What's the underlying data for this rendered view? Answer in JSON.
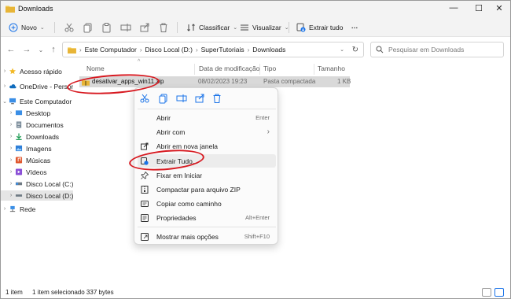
{
  "window": {
    "title": "Downloads"
  },
  "window_controls": {
    "minimize": "—",
    "maximize": "☐",
    "close": "✕"
  },
  "commandbar": {
    "new_label": "Novo",
    "sort_label": "Classificar",
    "view_label": "Visualizar",
    "extract_label": "Extrair tudo",
    "more_label": "···"
  },
  "addressbar": {
    "crumbs": [
      "Este Computador",
      "Disco Local (D:)",
      "SuperTutoriais",
      "Downloads"
    ],
    "separator": "›",
    "search_placeholder": "Pesquisar em Downloads"
  },
  "navpane": {
    "items": [
      {
        "label": "Acesso rápido",
        "level": 0,
        "chev": "›"
      },
      {
        "label": "OneDrive - Personal",
        "level": 0,
        "chev": "›"
      },
      {
        "label": "Este Computador",
        "level": 0,
        "chev": "⌄"
      },
      {
        "label": "Desktop",
        "level": 1,
        "chev": "›"
      },
      {
        "label": "Documentos",
        "level": 1,
        "chev": "›"
      },
      {
        "label": "Downloads",
        "level": 1,
        "chev": "›"
      },
      {
        "label": "Imagens",
        "level": 1,
        "chev": "›"
      },
      {
        "label": "Músicas",
        "level": 1,
        "chev": "›"
      },
      {
        "label": "Vídeos",
        "level": 1,
        "chev": "›"
      },
      {
        "label": "Disco Local (C:)",
        "level": 1,
        "chev": "›"
      },
      {
        "label": "Disco Local (D:)",
        "level": 1,
        "chev": "›",
        "selected": true
      },
      {
        "label": "Rede",
        "level": 0,
        "chev": "›"
      }
    ]
  },
  "filelist": {
    "columns": [
      "Nome",
      "Data de modificação",
      "Tipo",
      "Tamanho"
    ],
    "rows": [
      {
        "name": "desativar_apps_win11.zip",
        "date": "08/02/2023 19:23",
        "type": "Pasta compactada",
        "size": "1 KB"
      }
    ]
  },
  "context_menu": {
    "items": [
      {
        "label": "Abrir",
        "shortcut": "Enter",
        "icon": "none"
      },
      {
        "label": "Abrir com",
        "shortcut": "›",
        "icon": "none"
      },
      {
        "label": "Abrir em nova janela",
        "shortcut": "",
        "icon": "open-new-window-icon"
      },
      {
        "label": "Extrair Tudo...",
        "shortcut": "",
        "icon": "extract-icon",
        "highlighted": true
      },
      {
        "label": "Fixar em Iniciar",
        "shortcut": "",
        "icon": "pin-icon"
      },
      {
        "label": "Compactar para arquivo ZIP",
        "shortcut": "",
        "icon": "zip-icon"
      },
      {
        "label": "Copiar como caminho",
        "shortcut": "",
        "icon": "copy-path-icon"
      },
      {
        "label": "Propriedades",
        "shortcut": "Alt+Enter",
        "icon": "properties-icon"
      },
      {
        "label": "Mostrar mais opções",
        "shortcut": "Shift+F10",
        "icon": "more-options-icon"
      }
    ]
  },
  "statusbar": {
    "count": "1 item",
    "selection": "1 item selecionado  337 bytes"
  },
  "colors": {
    "annotation_red": "#d71920",
    "accent_blue": "#1a73e8",
    "folder_yellow": "#f2c94c"
  }
}
